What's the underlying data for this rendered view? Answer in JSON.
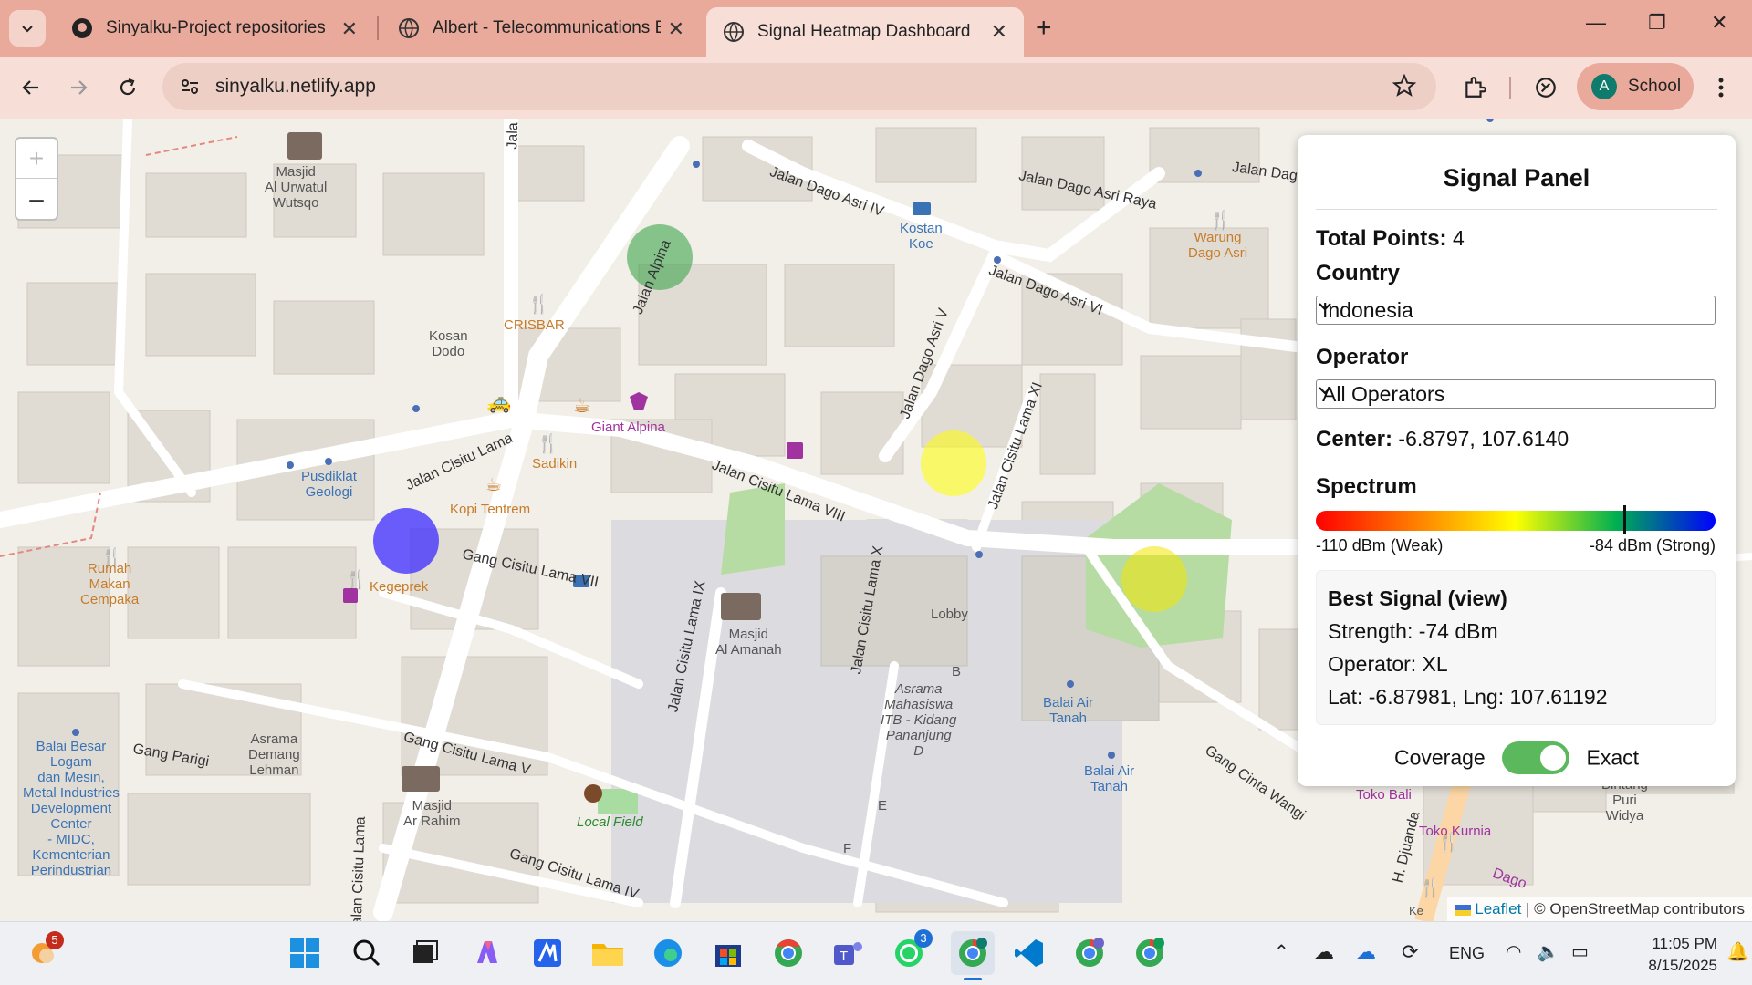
{
  "browser": {
    "tabs": [
      {
        "label": "Sinyalku-Project repositories",
        "icon": "github-icon"
      },
      {
        "label": "Albert - Telecommunications En",
        "icon": "globe-icon"
      },
      {
        "label": "Signal Heatmap Dashboard",
        "icon": "globe-icon",
        "active": true
      }
    ],
    "url": "sinyalku.netlify.app",
    "profile_initial": "A",
    "profile_label": "School"
  },
  "map": {
    "zoom_in": "+",
    "zoom_out": "–",
    "attribution_leaflet": "Leaflet",
    "attribution_rest": "| © OpenStreetMap contributors",
    "road_labels": [
      "Jalan Dago Asri IV",
      "Jalan Dago Asri Raya",
      "Jalan Dago Asri VI",
      "Jalan Dago Asri V",
      "Jalan Alpina",
      "Jalan Cisitu Lama",
      "Jalan Cisitu Lama VIII",
      "Jalan Cisitu Lama XI",
      "Gang Cisitu Lama VII",
      "Jalan Cisitu Lama IX",
      "Jalan Cisitu Lama X",
      "Gang Cisitu Lama V",
      "Gang Parigi",
      "Gang Cinta Wangi",
      "H. Djuanda",
      "Jalan Dag",
      "Jala",
      "Gang Cisitu Lama IV",
      "Dago"
    ],
    "poi_labels": {
      "masjid1": "Masjid\nAl Urwatul\nWutsqo",
      "kosan": "Kosan\nDodo",
      "crisbar": "CRISBAR",
      "giant": "Giant Alpina",
      "sadikin": "Sadikin",
      "pusdiklat": "Pusdiklat\nGeologi",
      "kopi": "Kopi Tentrem",
      "kegeprek": "Kegeprek",
      "rumah": "Rumah\nMakan\nCempaka",
      "kostan": "Kostan\nKoe",
      "warung": "Warung\nDago Asri",
      "masjid2": "Masjid\nAl Amanah",
      "lobby": "Lobby",
      "b": "B",
      "asrama1": "Asrama\nMahasiswa\nITB - Kidang\nPananjung\nD",
      "e": "E",
      "f": "F",
      "balaibesar": "Balai Besar\nLogam\ndan Mesin,\nMetal Industries\nDevelopment\nCenter\n- MIDC,\nKementerian\nPerindustrian",
      "asrama2": "Asrama\nDemang\nLehman",
      "masjid3": "Masjid\nAr Rahim",
      "localfield": "Local Field",
      "balaiair1": "Balai Air\nTanah",
      "balaiair2": "Balai Air\nTanah",
      "tokobali": "Toko Bali",
      "tokokurnia": "Toko Kurnia",
      "bintang": "Bintang\nPuri\nWidya",
      "ke": "Ke"
    },
    "heat_points": [
      {
        "color": "#2e9e3e",
        "strength": "strong"
      },
      {
        "color": "#ffff00",
        "strength": "medium"
      },
      {
        "color": "#3b2bff",
        "strength": "strongest"
      },
      {
        "color": "#f2e600",
        "strength": "medium"
      }
    ]
  },
  "panel": {
    "title": "Signal Panel",
    "total_label": "Total Points:",
    "total_value": "4",
    "country_label": "Country",
    "country_value": "Indonesia",
    "operator_label": "Operator",
    "operator_value": "All Operators",
    "center_label": "Center:",
    "center_value": "-6.8797, 107.6140",
    "spectrum_label": "Spectrum",
    "spectrum_min": "-110 dBm (Weak)",
    "spectrum_max": "-84 dBm (Strong)",
    "spectrum_marker_dbm": -90,
    "best_title": "Best Signal (view)",
    "best_strength": "Strength: -74 dBm",
    "best_operator": "Operator: XL",
    "best_latlng": "Lat: -6.87981, Lng: 107.61192",
    "toggle_left": "Coverage",
    "toggle_right": "Exact",
    "toggle_on": true
  },
  "taskbar": {
    "apps": [
      "weather-icon",
      "windows-start-icon",
      "search-icon",
      "task-view-icon",
      "copilot-icon",
      "app-icon",
      "file-explorer-icon",
      "edge-icon",
      "store-icon",
      "chrome-icon",
      "teams-icon",
      "whatsapp-icon",
      "chrome-profile-icon",
      "vscode-icon",
      "chrome-icon",
      "chrome-icon"
    ],
    "weather_badge": "5",
    "whatsapp_badge": "3",
    "lang": "ENG",
    "time": "11:05 PM",
    "date": "8/15/2025"
  }
}
